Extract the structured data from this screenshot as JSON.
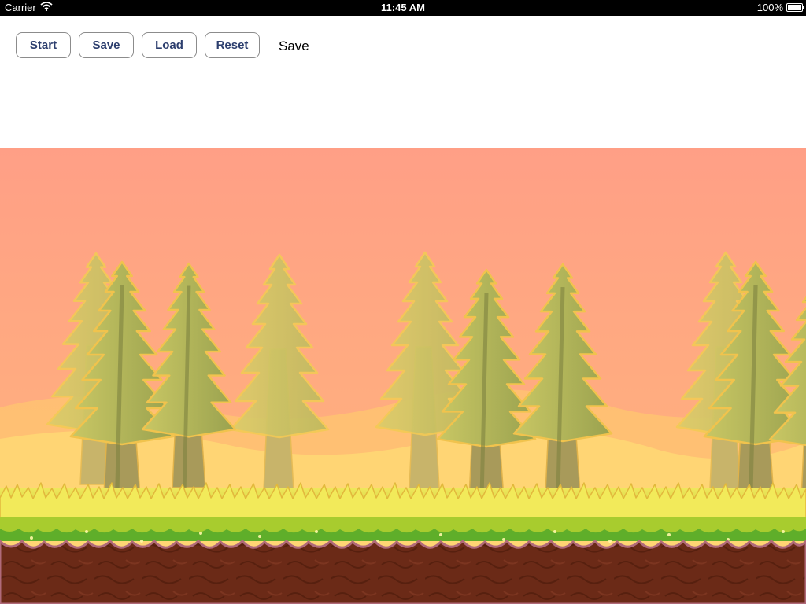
{
  "status_bar": {
    "carrier": "Carrier",
    "time": "11:45 AM",
    "battery": "100%",
    "battery_level": 1.0
  },
  "toolbar": {
    "start_label": "Start",
    "save_label": "Save",
    "load_label": "Load",
    "reset_label": "Reset",
    "status_text": "Save"
  },
  "colors": {
    "sky": "#ffa188",
    "hills": "#ffd872",
    "grass": "#e6e85a",
    "ground": "#6b2a17",
    "button_text": "#2c3e6e"
  }
}
